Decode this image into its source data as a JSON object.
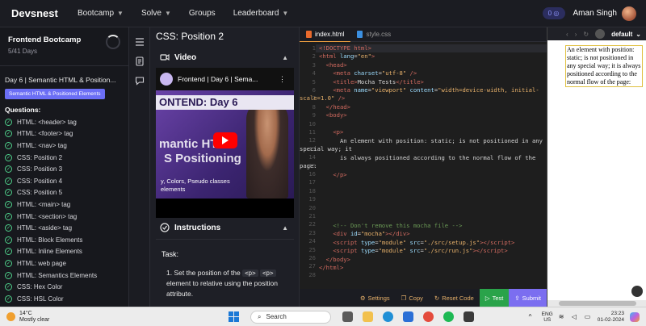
{
  "nav": {
    "brand": "Devsnest",
    "items": [
      {
        "label": "Bootcamp",
        "dropdown": true
      },
      {
        "label": "Solve",
        "dropdown": true
      },
      {
        "label": "Groups",
        "dropdown": false
      },
      {
        "label": "Leaderboard",
        "dropdown": true
      }
    ],
    "points": "0",
    "username": "Aman Singh"
  },
  "sidebar": {
    "course_title": "Frontend Bootcamp",
    "course_days": "5/41 Days",
    "lesson_title": "Day 6 | Semantic HTML & Position...",
    "lesson_tag": "Semantic HTML & Positioned Elements",
    "questions_heading": "Questions:",
    "questions": [
      "HTML: <header> tag",
      "HTML: <footer> tag",
      "HTML: <nav> tag",
      "CSS: Position 2",
      "CSS: Position 3",
      "CSS: Position 4",
      "CSS: Position 5",
      "HTML: <main> tag",
      "HTML: <section> tag",
      "HTML: <aside> tag",
      "HTML: Block Elements",
      "HTML: Inline Elements",
      "HTML: web page",
      "HTML: Semantics Elements",
      "CSS: Hex Color",
      "CSS: HSL Color"
    ]
  },
  "problem": {
    "title": "CSS: Position 2",
    "video_heading": "Video",
    "video_title": "Frontend | Day 6 | Sema...",
    "thumb_line1": "ONTEND: Day 6",
    "thumb_line2": "mantic HTML",
    "thumb_line3": "S Positioning",
    "thumb_line4": "y, Colors, Pseudo classes",
    "thumb_line5": "elements",
    "instructions_heading": "Instructions",
    "task_label": "Task:",
    "step_number": "1.",
    "step_pre": "Set the position of the",
    "step_chip1": "<p>",
    "step_chip2": "<p>",
    "step_post": "element to relative using the position attribute."
  },
  "editor": {
    "tabs": [
      {
        "label": "index.html",
        "active": true,
        "color": "#e8692c"
      },
      {
        "label": "style.css",
        "active": false,
        "color": "#3b8fe0"
      }
    ],
    "line_numbers": [
      "1",
      "2",
      "3",
      "4",
      "5",
      "6",
      "7",
      "8",
      "9",
      "10",
      "11",
      "12",
      "13",
      "14",
      "15",
      "16",
      "17",
      "18",
      "19",
      "20",
      "21",
      "22",
      "23",
      "24",
      "25",
      "26",
      "27",
      "28"
    ],
    "bar": {
      "settings": "Settings",
      "copy": "Copy",
      "reset": "Reset Code",
      "test": "Test",
      "submit": "Submit"
    }
  },
  "preview": {
    "select_value": "default",
    "text": "An element with position: static; is not positioned in any special way; it is always positioned according to the normal flow of the page:"
  },
  "taskbar": {
    "temp": "14°C",
    "weather": "Mostly clear",
    "search_placeholder": "Search",
    "lang1": "ENG",
    "lang2": "US",
    "time": "23:23",
    "date": "01-02-2024"
  }
}
